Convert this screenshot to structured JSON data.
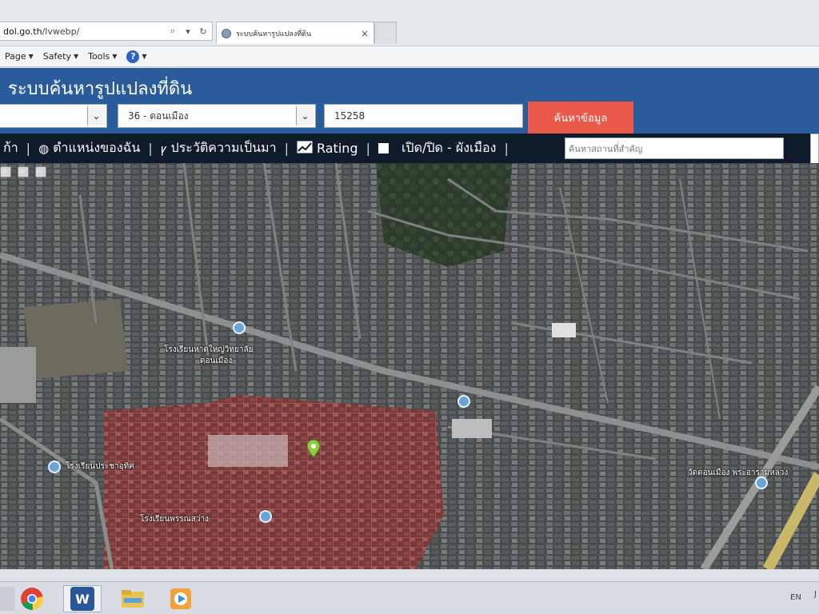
{
  "browser": {
    "url_prefix": "",
    "url_host": "dol.go.th",
    "url_path": "/lvwebp/",
    "tab_title": "ระบบค้นหารูปแปลงที่ดิน",
    "tab_close": "×",
    "search_glyph": "⌕",
    "dropdown_glyph": "▾",
    "refresh_glyph": "↻",
    "commands": [
      {
        "label": "Page"
      },
      {
        "label": "Safety"
      },
      {
        "label": "Tools"
      }
    ],
    "help_label": "?"
  },
  "app": {
    "title": "ระบบค้นหารูปแปลงที่ดิน",
    "province_select": "",
    "district_select": "36 - ดอนเมือง",
    "parcel_input": "15258",
    "search_button": "ค้นหาข้อมูล",
    "menu": {
      "home_partial": "ก้า",
      "my_location": "ตำแหน่งของฉัน",
      "history": "ประวัติความเป็นมา",
      "rating": "Rating",
      "toggle_cityplan": "เปิด/ปิด - ผังเมือง",
      "landmark_placeholder": "ค้นหาสถานที่สำคัญ"
    }
  },
  "map": {
    "labels": [
      {
        "text": "โรงเรียนหาดใหญ่วิทยาลัย",
        "cls": "l1"
      },
      {
        "text": "ดอนเมือง",
        "cls": "l2"
      },
      {
        "text": "โรงเรียนประชาอุทิศ",
        "cls": "l3"
      },
      {
        "text": "วัดดอนเมือง พระอารามหลวง",
        "cls": "l4"
      },
      {
        "text": "โรงเรียนพรรณสว่าง",
        "cls": "l5"
      }
    ]
  },
  "taskbar": {
    "lang": "EN",
    "word_label": "W",
    "tray_extra": "J"
  },
  "colors": {
    "header_blue": "#2a5c9c",
    "menubar_dark": "#0f1a2b",
    "search_button": "#ea5a4a"
  }
}
